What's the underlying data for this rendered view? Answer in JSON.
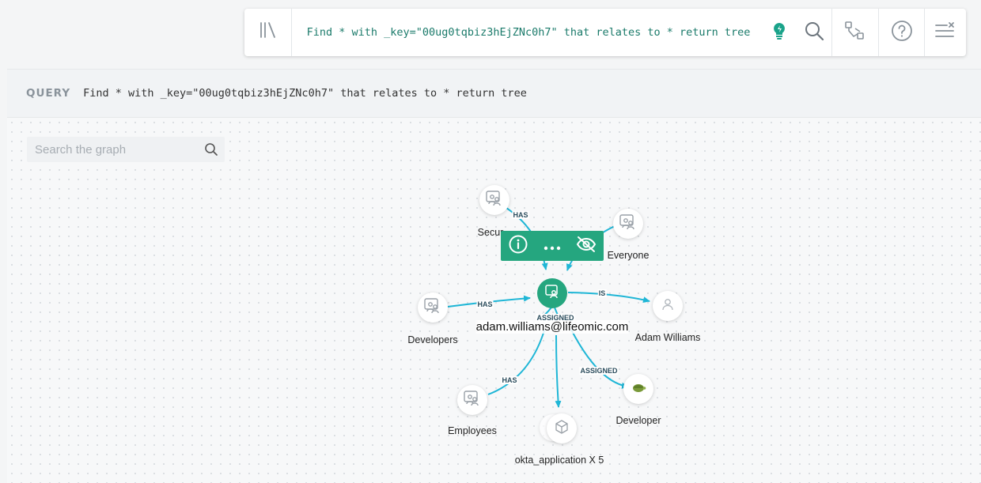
{
  "topbar": {
    "library_icon": "library-icon",
    "query_value": "Find * with _key=\"00ug0tqbiz3hEjZNc0h7\" that relates to * return tree",
    "icons": [
      "lightbulb-icon",
      "search-icon",
      "graph-toggle-icon",
      "help-icon",
      "menu-close-icon"
    ]
  },
  "query_bar": {
    "label": "QUERY",
    "text": "Find * with _key=\"00ug0tqbiz3hEjZNc0h7\" that relates to * return tree"
  },
  "graph": {
    "search_placeholder": "Search the graph",
    "center": {
      "label": "adam.williams@lifeomic.com",
      "icon": "user-group-icon"
    },
    "nodes": [
      {
        "id": "security",
        "label": "Secur",
        "icon": "user-group-icon"
      },
      {
        "id": "everyone",
        "label": "Everyone",
        "icon": "user-group-icon"
      },
      {
        "id": "developers",
        "label": "Developers",
        "icon": "user-group-icon"
      },
      {
        "id": "adam",
        "label": "Adam Williams",
        "icon": "person-icon"
      },
      {
        "id": "employees",
        "label": "Employees",
        "icon": "user-group-icon"
      },
      {
        "id": "developer",
        "label": "Developer",
        "icon": "turtle-icon"
      },
      {
        "id": "okta",
        "label": "okta_application X 5",
        "icon": "cube-icon"
      }
    ],
    "edge_labels": {
      "security": "HAS",
      "developers": "HAS",
      "adam": "IS",
      "assigned_top": "ASSIGNED",
      "developer": "ASSIGNED",
      "employees": "HAS"
    },
    "toolbar_icons": [
      "info-icon",
      "more-icon",
      "hide-icon"
    ]
  },
  "colors": {
    "accent": "#25a67f",
    "edge": "#1fb6d6",
    "query_text": "#1a7a6a"
  }
}
